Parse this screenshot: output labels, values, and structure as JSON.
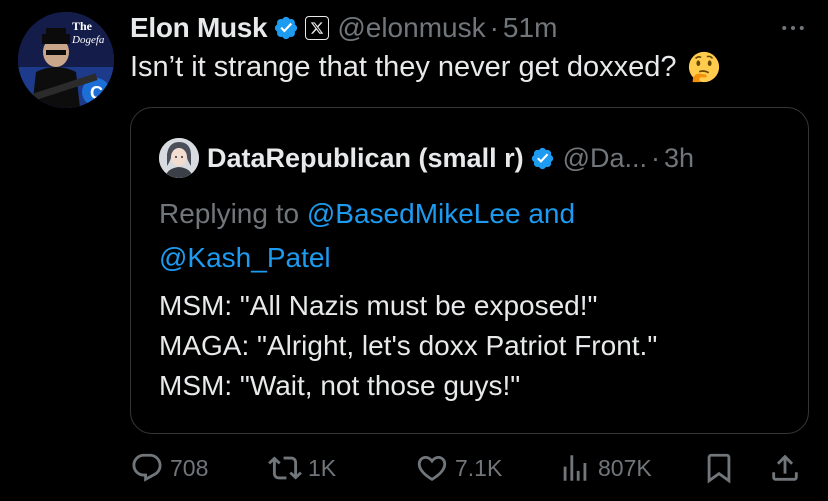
{
  "author": {
    "name": "Elon Musk",
    "handle": "@elonmusk",
    "time": "51m",
    "avatar_text_line1": "The",
    "avatar_text_line2": "Dogefa"
  },
  "tweet": {
    "text": "Isn’t it strange that they never get doxxed?",
    "emoji_icon": "thinking-face-icon"
  },
  "quoted": {
    "name": "DataRepublican (small r)",
    "handle": "@Da...",
    "time": "3h",
    "replying_prefix": "Replying to",
    "mention1": "@BasedMikeLee",
    "conjunction": "and",
    "mention2": "@Kash_Patel",
    "lines": [
      "MSM: \"All Nazis must be exposed!\"",
      "MAGA: \"Alright, let's doxx Patriot Front.\"",
      "MSM: \"Wait, not those guys!\""
    ]
  },
  "actions": {
    "replies": "708",
    "reposts": "1K",
    "likes": "7.1K",
    "views": "807K"
  },
  "colors": {
    "background": "#000000",
    "text": "#e7e9ea",
    "muted": "#71767b",
    "accent": "#1d9bf0",
    "border": "#333639"
  }
}
